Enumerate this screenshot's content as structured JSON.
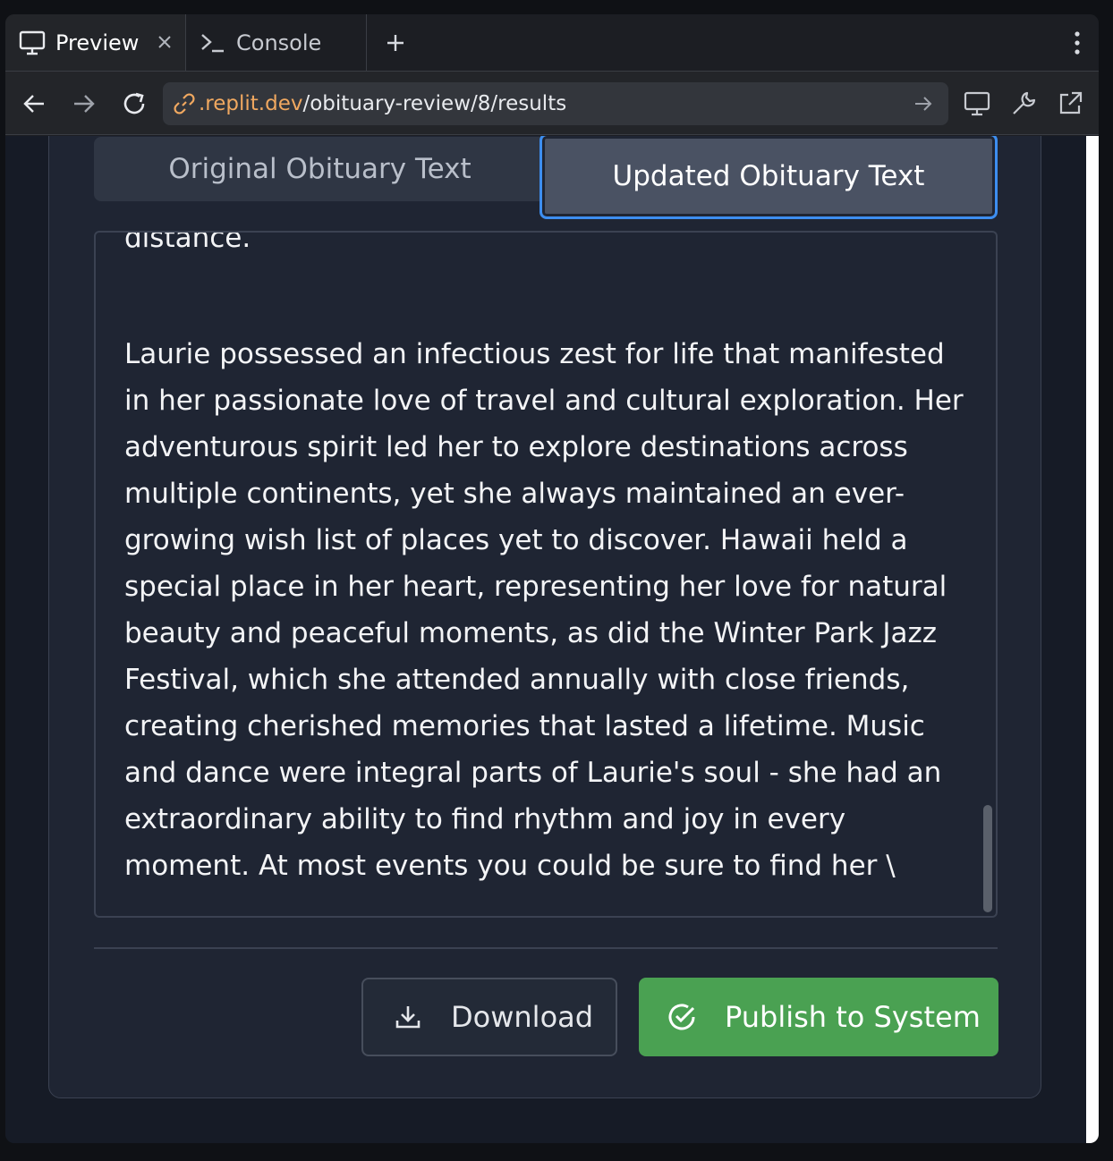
{
  "browser": {
    "tabs": [
      {
        "label": "Preview",
        "icon": "monitor-icon",
        "active": true
      },
      {
        "label": "Console",
        "icon": "terminal-icon",
        "active": false
      }
    ],
    "new_tab": "+",
    "url": {
      "host": ".replit.dev",
      "path": "/obituary-review/8/results"
    }
  },
  "page": {
    "tabs": {
      "original_label": "Original Obituary Text",
      "updated_label": "Updated Obituary Text",
      "selected": "updated"
    },
    "text": {
      "cut_line": "distance.",
      "paragraph": "Laurie possessed an infectious zest for life that manifested in her passionate love of travel and cultural exploration. Her adventurous spirit led her to explore destinations across multiple continents, yet she always maintained an ever-growing wish list of places yet to discover. Hawaii held a special place in her heart, representing her love for natural beauty and peaceful moments, as did the Winter Park Jazz Festival, which she attended annually with close friends, creating cherished memories that lasted a lifetime. Music and dance were integral parts of Laurie's soul - she had an extraordinary ability to find rhythm and joy in every moment. At most events you could be sure to find her \\"
    },
    "actions": {
      "download_label": "Download",
      "publish_label": "Publish to System"
    }
  },
  "colors": {
    "accent_blue": "#3d8ef0",
    "publish_green": "#4aa152",
    "url_host": "#f0a860"
  }
}
